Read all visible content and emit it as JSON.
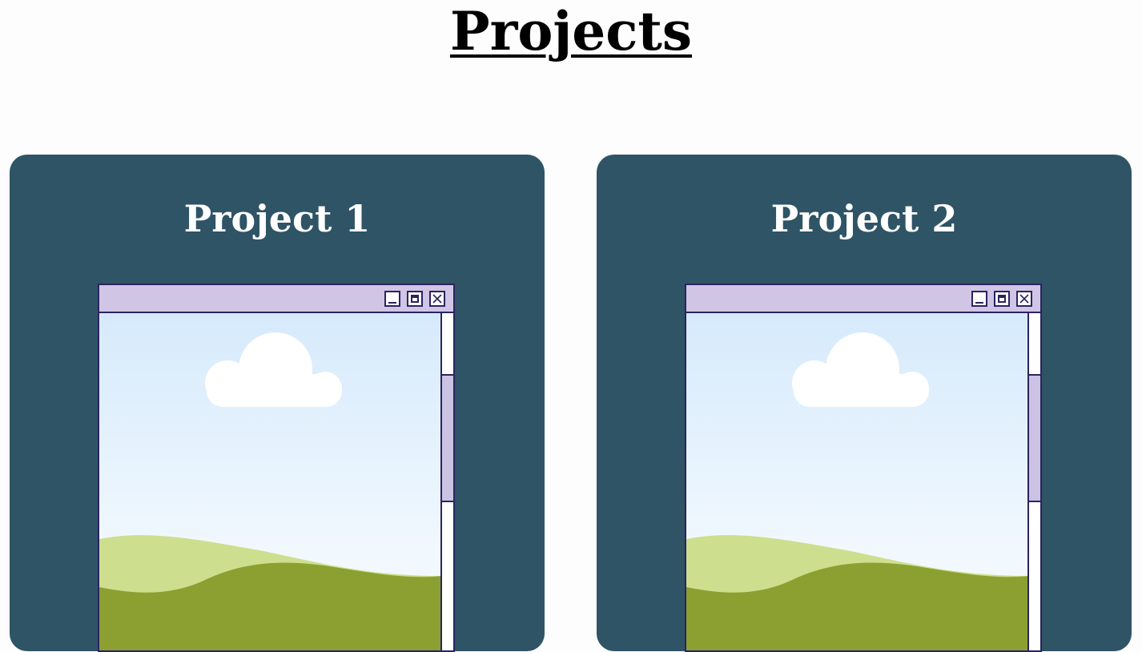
{
  "page": {
    "title": "Projects"
  },
  "colors": {
    "card_background": "#2e5466",
    "window_border": "#2b2460",
    "titlebar": "#d0c5e5",
    "scroll_thumb": "#cbc2e4",
    "sky_top": "#d6eafc",
    "hill_light": "#cddf8e",
    "hill_dark": "#8ca032",
    "cloud": "#ffffff"
  },
  "projects": [
    {
      "title": "Project 1",
      "window_controls": [
        "minimize-icon",
        "maximize-icon",
        "close-icon"
      ],
      "scene": [
        "cloud",
        "hills"
      ]
    },
    {
      "title": "Project 2",
      "window_controls": [
        "minimize-icon",
        "maximize-icon",
        "close-icon"
      ],
      "scene": [
        "cloud",
        "hills"
      ]
    }
  ]
}
